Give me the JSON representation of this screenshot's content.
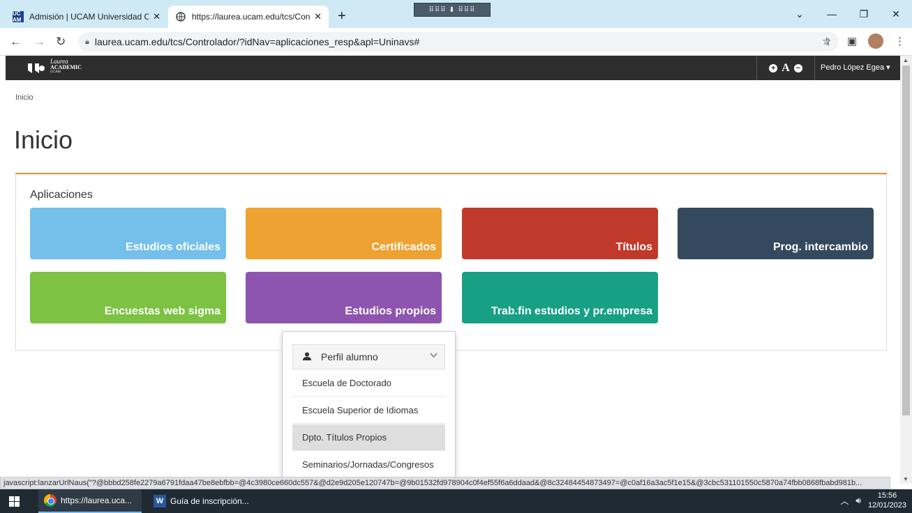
{
  "browser": {
    "tabs": [
      {
        "title": "Admisión | UCAM Universidad Ca",
        "favicon": "UC AM",
        "active": false
      },
      {
        "title": "https://laurea.ucam.edu/tcs/Cont",
        "active": true
      }
    ],
    "new_tab": "+",
    "url": "laurea.ucam.edu/tcs/Controlador/?idNav=aplicaciones_resp&apl=Uninavs#"
  },
  "site": {
    "logo": {
      "line1": "Laurea",
      "line2": "ACADEMIC",
      "line3": "UCAM"
    },
    "font_tools": {
      "increase": "+",
      "letter": "A",
      "decrease": "−"
    },
    "user": "Pedro López Egea ▾"
  },
  "breadcrumb": "Inicio",
  "page_title": "Inicio",
  "apps": {
    "heading": "Aplicaciones",
    "tiles": [
      {
        "label": "Estudios oficiales",
        "color": "#74c0ea"
      },
      {
        "label": "Certificados",
        "color": "#eda232"
      },
      {
        "label": "Títulos",
        "color": "#c0392b"
      },
      {
        "label": "Prog. intercambio",
        "color": "#34495e"
      },
      {
        "label": "Encuestas web sigma",
        "color": "#7dc242"
      },
      {
        "label": "Estudios propios",
        "color": "#8e55b0"
      },
      {
        "label": "Trab.fin estudios y pr.empresa",
        "color": "#17a085"
      }
    ]
  },
  "dropdown": {
    "selected": "Perfil alumno",
    "items": [
      "Escuela de Doctorado",
      "Escuela Superior de Idiomas",
      "Dpto. Títulos Propios",
      "Seminarios/Jornadas/Congresos"
    ],
    "hovered_index": 2
  },
  "status_bar": "javascript:lanzarUrlNaus(\"?@bbbd258fe2279a6791fdaa47be8ebfbb=@4c3980ce660dc557&@d2e9d205e120747b=@9b01532fd978904c0f4ef55f6a6ddaad&@8c32484454873497=@c0af16a3ac5f1e15&@3cbc531101550c5870a74fbb0868fbabd981b...",
  "taskbar": {
    "items": [
      {
        "label": "https://laurea.uca..."
      },
      {
        "label": "Guía de inscripción..."
      }
    ],
    "time": "15:56",
    "date": "12/01/2023"
  }
}
